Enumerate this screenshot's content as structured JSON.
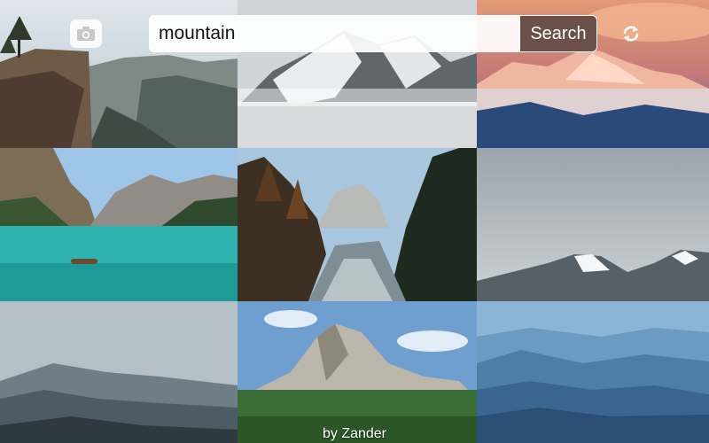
{
  "search": {
    "value": "mountain",
    "button_label": "Search"
  },
  "icons": {
    "camera": "camera-icon",
    "refresh": "refresh-icon"
  },
  "footer": {
    "credit": "by Zander"
  },
  "colors": {
    "search_button": "#6a5048"
  }
}
